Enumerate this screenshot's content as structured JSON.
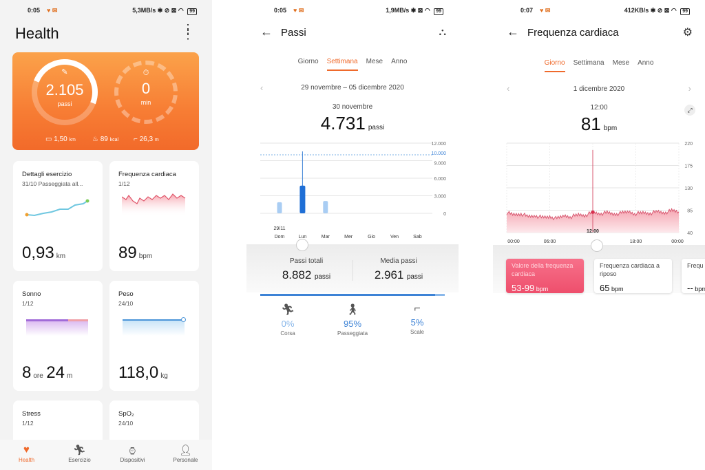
{
  "screen1": {
    "status": {
      "time": "0:05",
      "speed": "5,3MB/s",
      "battery": "99"
    },
    "title": "Health",
    "hero": {
      "steps_value": "2.105",
      "steps_unit": "passi",
      "steps_progress": 0.35,
      "min_value": "0",
      "min_unit": "min",
      "distance": "1,50",
      "distance_unit": "km",
      "calories": "89",
      "calories_unit": "kcal",
      "floors": "26,3",
      "floors_unit": "m"
    },
    "cards": [
      {
        "title": "Dettagli esercizio",
        "sub": "31/10 Passeggiata all...",
        "value": "0,93",
        "unit": "km"
      },
      {
        "title": "Frequenza cardiaca",
        "sub": "1/12",
        "value": "89",
        "unit": "bpm"
      },
      {
        "title": "Sonno",
        "sub": "1/12",
        "value": "8",
        "unit": "ore",
        "value2": "24",
        "unit2": "m"
      },
      {
        "title": "Peso",
        "sub": "24/10",
        "value": "118,0",
        "unit": "kg"
      },
      {
        "title": "Stress",
        "sub": "1/12"
      },
      {
        "title": "SpO₂",
        "sub": "24/10"
      }
    ],
    "nav": [
      "Health",
      "Esercizio",
      "Dispositivi",
      "Personale"
    ]
  },
  "screen2": {
    "status": {
      "time": "0:05",
      "speed": "1,9MB/s",
      "battery": "99"
    },
    "title": "Passi",
    "tabs": [
      "Giorno",
      "Settimana",
      "Mese",
      "Anno"
    ],
    "range": "29 novembre – 05 dicembre 2020",
    "selected_day": "30 novembre",
    "selected_value": "4.731",
    "unit": "passi",
    "y_labels": [
      "12.000",
      "10.000",
      "9.000",
      "6.000",
      "3.000",
      "0"
    ],
    "chart_data": {
      "type": "bar",
      "categories": [
        "Dom",
        "Lun",
        "Mar",
        "Mer",
        "Gio",
        "Ven",
        "Sab"
      ],
      "date_label": "29/11",
      "values": [
        1900,
        4731,
        2100,
        0,
        0,
        0,
        0
      ],
      "goal": 10000,
      "ylim": [
        0,
        12000
      ]
    },
    "totals": {
      "label1": "Passi totali",
      "value1": "8.882",
      "unit1": "passi",
      "label2": "Media passi",
      "value2": "2.961",
      "unit2": "passi"
    },
    "activities": [
      {
        "pct": "0%",
        "label": "Corsa"
      },
      {
        "pct": "95%",
        "label": "Passeggiata"
      },
      {
        "pct": "5%",
        "label": "Scale"
      }
    ]
  },
  "screen3": {
    "status": {
      "time": "0:07",
      "speed": "412KB/s",
      "battery": "99"
    },
    "title": "Frequenza cardiaca",
    "tabs": [
      "Giorno",
      "Settimana",
      "Mese",
      "Anno"
    ],
    "date": "1 dicembre 2020",
    "time_sel": "12:00",
    "value": "81",
    "unit": "bpm",
    "y_labels": [
      "220",
      "175",
      "130",
      "85",
      "40"
    ],
    "x_labels": [
      "00:00",
      "06:00",
      "12:00",
      "18:00",
      "00:00"
    ],
    "chart_data": {
      "type": "area",
      "x_hours": [
        0,
        1,
        2,
        3,
        4,
        5,
        6,
        7,
        8,
        9,
        10,
        11,
        12,
        13,
        14,
        15,
        16,
        17,
        18,
        19,
        20,
        21,
        22,
        23,
        24
      ],
      "y": [
        80,
        76,
        78,
        72,
        74,
        70,
        72,
        68,
        74,
        72,
        76,
        75,
        81,
        78,
        80,
        77,
        79,
        82,
        78,
        80,
        79,
        82,
        80,
        84,
        82
      ],
      "ylim": [
        40,
        220
      ]
    },
    "cards": [
      {
        "title": "Valore della frequenza cardiaca",
        "value": "53-99",
        "unit": "bpm"
      },
      {
        "title": "Frequenza cardiaca a riposo",
        "value": "65",
        "unit": "bpm"
      },
      {
        "title": "Frequ eleva",
        "value": "--",
        "unit": "bpm"
      }
    ]
  }
}
